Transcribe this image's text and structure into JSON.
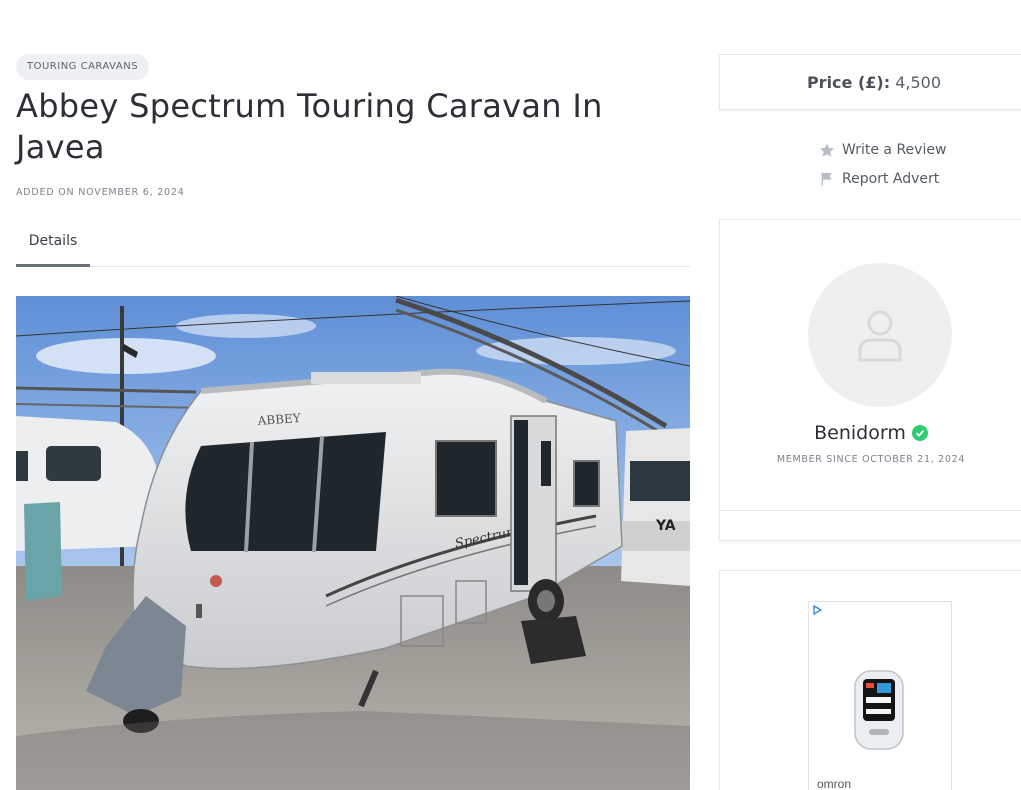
{
  "listing": {
    "category": "TOURING CARAVANS",
    "title": "Abbey Spectrum Touring Caravan In Javea",
    "added_on": "ADDED ON NOVEMBER 6, 2024",
    "tabs": [
      {
        "label": "Details",
        "active": true
      }
    ],
    "photo": {
      "brand_decal": "ABBEY",
      "model_decal": "Spectrum"
    }
  },
  "sidebar": {
    "price": {
      "label": "Price (£):",
      "value": "4,500"
    },
    "actions": [
      {
        "label": "Write a Review",
        "icon": "star-icon"
      },
      {
        "label": "Report Advert",
        "icon": "flag-icon"
      }
    ],
    "seller": {
      "name": "Benidorm",
      "verified": true,
      "member_since": "MEMBER SINCE OCTOBER 21, 2024"
    },
    "ad": {
      "brand": "omron",
      "icon": "ad-choices-icon"
    }
  },
  "colors": {
    "verified": "#2ecc71",
    "badge_bg": "#eef0f3",
    "text_dark": "#2c2f36",
    "text_muted": "#7d838c",
    "border": "#e6e8eb"
  }
}
